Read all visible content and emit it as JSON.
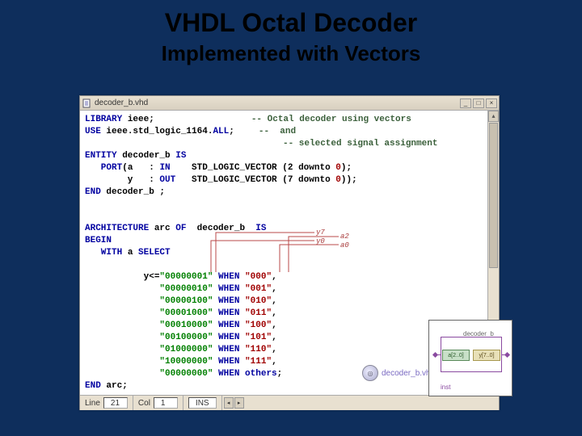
{
  "header": {
    "title": "VHDL Octal Decoder",
    "subtitle": "Implemented with Vectors"
  },
  "window": {
    "title": "decoder_b.vhd",
    "min": "_",
    "max": "□",
    "close": "×"
  },
  "code": {
    "l1_a": "LIBRARY",
    "l1_b": " ieee;",
    "c1": "-- Octal decoder using vectors",
    "l2_a": "USE",
    "l2_b": " ieee.std_logic_1164.",
    "l2_c": "ALL",
    "l2_d": ";",
    "c2": "--  and",
    "c3": "-- selected signal assignment",
    "l4_a": "ENTITY",
    "l4_b": " decoder_b ",
    "l4_c": "IS",
    "l5_a": "   PORT",
    "l5_b": "(a   : ",
    "l5_c": "IN",
    "l5_d": "    STD_LOGIC_VECTOR (2 downto ",
    "l5_e": "0",
    "l5_f": ");",
    "l6_a": "        y   : ",
    "l6_c": "OUT",
    "l6_d": "   STD_LOGIC_VECTOR (7 downto ",
    "l6_e": "0",
    "l6_f": "));",
    "l7_a": "END",
    "l7_b": " decoder_b ;",
    "l9_a": "ARCHITECTURE",
    "l9_b": " arc ",
    "l9_c": "OF",
    "l9_d": "  decoder_b  ",
    "l9_e": "IS",
    "l10_a": "BEGIN",
    "l11_a": "   WITH",
    "l11_b": " a ",
    "l11_c": "SELECT",
    "r1_a": "           y<=",
    "r1_g": "\"00000001\"",
    "r1_b": " WHEN ",
    "r1_r": "\"000\"",
    "r1_c": ",",
    "r2_a": "              ",
    "r2_g": "\"00000010\"",
    "r2_b": " WHEN ",
    "r2_r": "\"001\"",
    "r2_c": ",",
    "r3_a": "              ",
    "r3_g": "\"00000100\"",
    "r3_b": " WHEN ",
    "r3_r": "\"010\"",
    "r3_c": ",",
    "r4_a": "              ",
    "r4_g": "\"00001000\"",
    "r4_b": " WHEN ",
    "r4_r": "\"011\"",
    "r4_c": ",",
    "r5_a": "              ",
    "r5_g": "\"00010000\"",
    "r5_b": " WHEN ",
    "r5_r": "\"100\"",
    "r5_c": ",",
    "r6_a": "              ",
    "r6_g": "\"00100000\"",
    "r6_b": " WHEN ",
    "r6_r": "\"101\"",
    "r6_c": ",",
    "r7_a": "              ",
    "r7_g": "\"01000000\"",
    "r7_b": " WHEN ",
    "r7_r": "\"110\"",
    "r7_c": ",",
    "r8_a": "              ",
    "r8_g": "\"10000000\"",
    "r8_b": " WHEN ",
    "r8_r": "\"111\"",
    "r8_c": ",",
    "r9_a": "              ",
    "r9_g": "\"00000000\"",
    "r9_b": " WHEN ",
    "r9_c": "others",
    "r9_d": ";",
    "l20_a": "END",
    "l20_b": " arc;"
  },
  "annot": {
    "y7": "y7",
    "y0": "y0",
    "a2": "a2",
    "a0": "a0"
  },
  "status": {
    "line_label": "Line",
    "line_val": "21",
    "col_label": "Col",
    "col_val": "1",
    "ins": "INS"
  },
  "file_chip": {
    "label": "decoder_b.vhd"
  },
  "diagram": {
    "title": "decoder_b",
    "port_a": "a[2..0]",
    "port_y": "y[7..0]",
    "inst": "inst"
  }
}
